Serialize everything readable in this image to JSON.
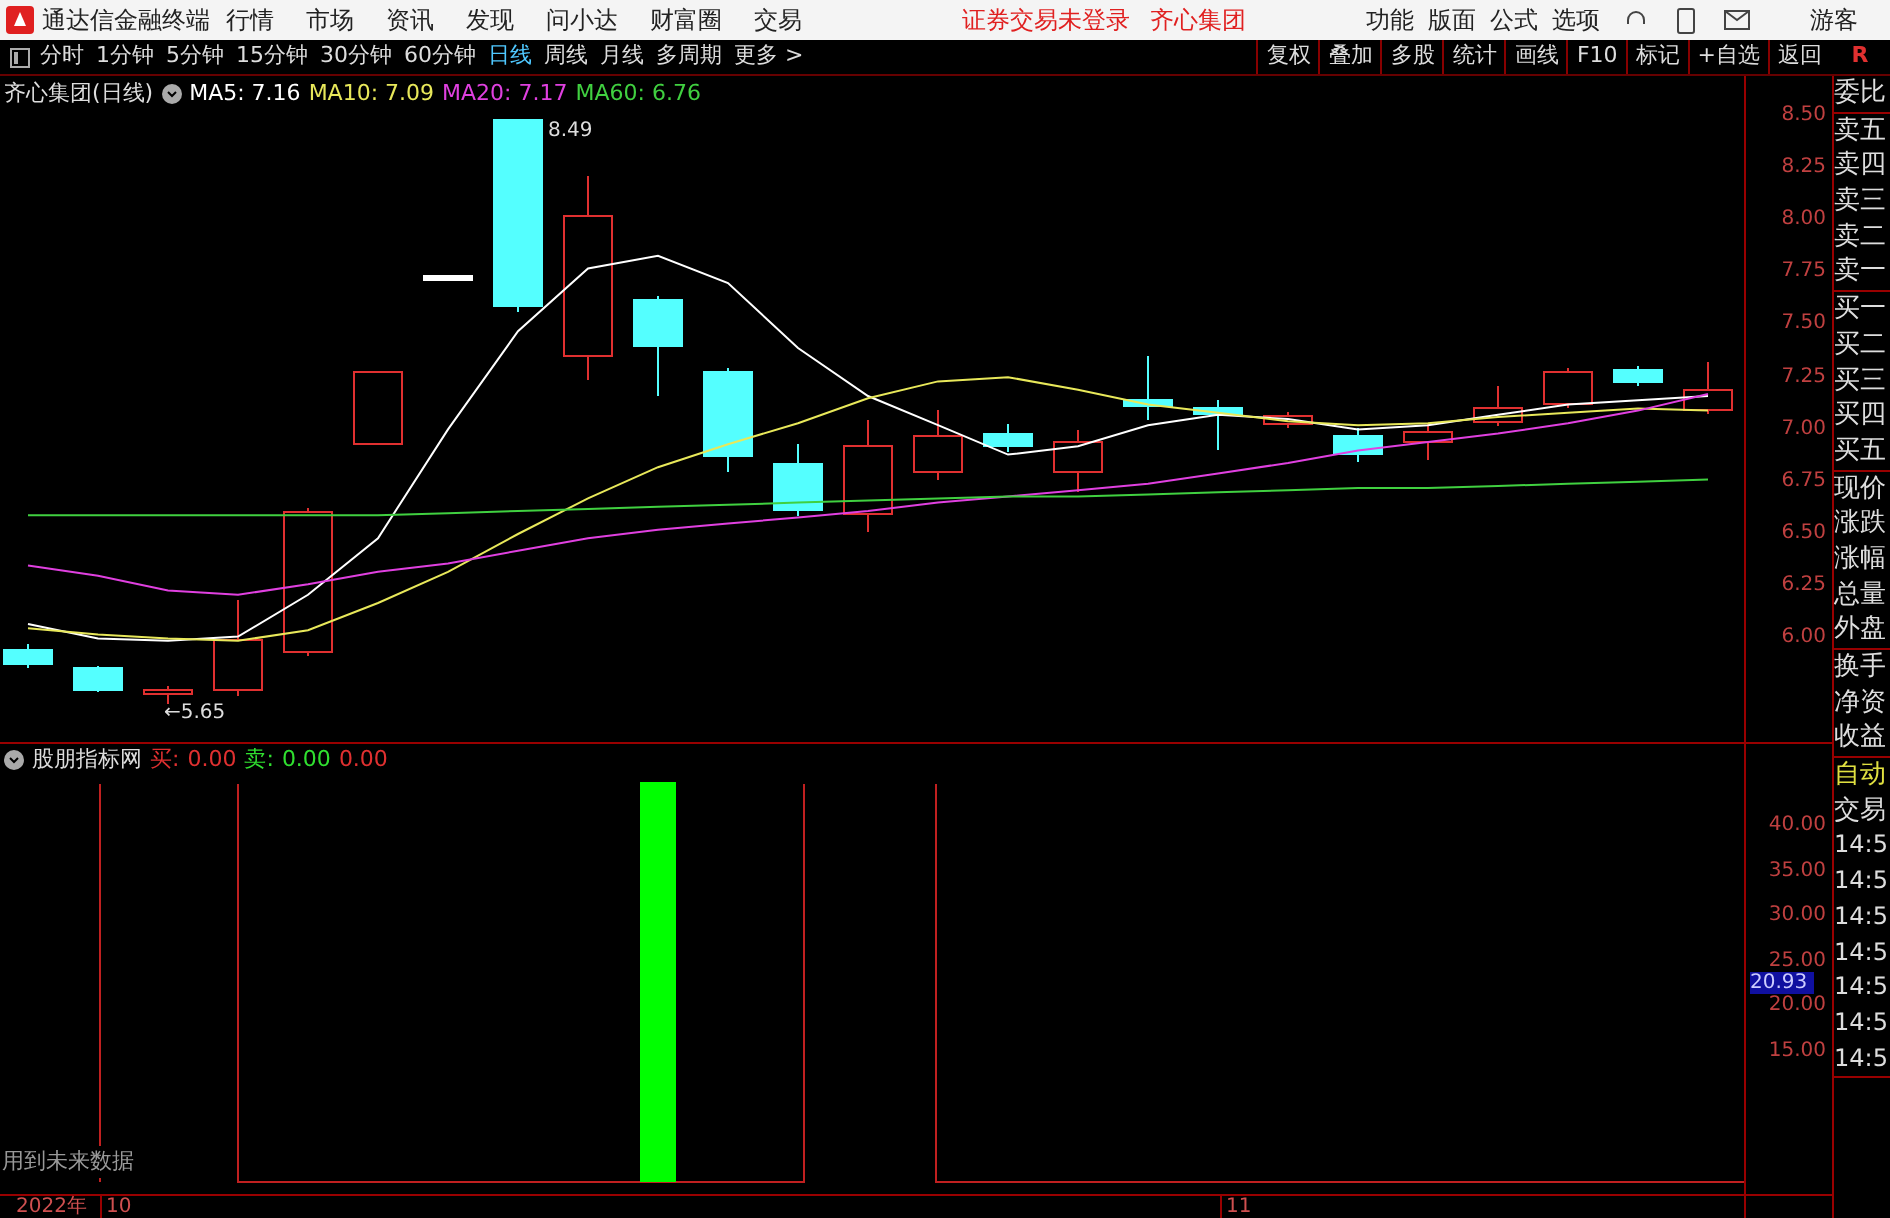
{
  "menu_bar": {
    "app_title": "通达信金融终端",
    "items": [
      "行情",
      "市场",
      "资讯",
      "发现",
      "问小达",
      "财富圈",
      "交易"
    ],
    "notices": [
      "证券交易未登录",
      "齐心集团"
    ],
    "right_items": [
      "功能",
      "版面",
      "公式",
      "选项"
    ],
    "user": "游客"
  },
  "toolbar": {
    "periods": [
      {
        "label": "分时",
        "selected": false
      },
      {
        "label": "1分钟",
        "selected": false
      },
      {
        "label": "5分钟",
        "selected": false
      },
      {
        "label": "15分钟",
        "selected": false
      },
      {
        "label": "30分钟",
        "selected": false
      },
      {
        "label": "60分钟",
        "selected": false
      },
      {
        "label": "日线",
        "selected": true
      },
      {
        "label": "周线",
        "selected": false
      },
      {
        "label": "月线",
        "selected": false
      },
      {
        "label": "多周期",
        "selected": false
      },
      {
        "label": "更多 >",
        "selected": false
      }
    ],
    "buttons": [
      "复权",
      "叠加",
      "多股",
      "统计",
      "画线",
      "F10",
      "标记",
      "+自选",
      "返回"
    ],
    "corner": "R"
  },
  "main_chart": {
    "title": "齐心集团(日线)",
    "indicators": [
      ": 7.16",
      ": 7.09",
      ": 7.17",
      ": 6.76"
    ],
    "high_label": "8.49",
    "low_label": "←5.65",
    "chart_data": {
      "type": "line",
      "categories": [
        null,
        null,
        null,
        null,
        null,
        null,
        null,
        null,
        null,
        null,
        null,
        null,
        null,
        null,
        null,
        null,
        null,
        null,
        null,
        null,
        null,
        null,
        null,
        null,
        null
      ],
      "ylim": [
        3.23,
        8.69
      ],
      "yticks": [
        {
          "value": 8.5,
          "label": "8.50"
        },
        {
          "value": 8.25,
          "label": "8.25"
        },
        {
          "value": 8.0,
          "label": "8.00"
        },
        {
          "value": 7.75,
          "label": "7.75"
        },
        {
          "value": 7.5,
          "label": "7.50"
        },
        {
          "value": 7.25,
          "label": "7.25"
        },
        {
          "value": 7.0,
          "label": "7.00"
        },
        {
          "value": 6.75,
          "label": "6.75"
        },
        {
          "value": 6.5,
          "label": "6.50"
        },
        {
          "value": 6.25,
          "label": "6.25"
        },
        {
          "value": 6.0,
          "label": "6.00"
        }
      ],
      "series": [
        {
          "name": "MA5",
          "color": "#ffffff",
          "values": [
            6.07,
            6.0,
            5.99,
            6.01,
            6.21,
            6.48,
            7.0,
            7.47,
            7.77,
            7.83,
            7.7,
            7.39,
            7.16,
            7.02,
            6.88,
            6.92,
            7.02,
            7.07,
            7.05,
            7.0,
            7.02,
            7.07,
            7.12,
            7.14,
            7.16
          ]
        },
        {
          "name": "MA10",
          "color": "#e8e85a",
          "values": [
            6.05,
            6.02,
            6.0,
            5.99,
            6.04,
            6.17,
            6.32,
            6.5,
            6.67,
            6.82,
            6.93,
            7.03,
            7.15,
            7.23,
            7.25,
            7.19,
            7.12,
            7.08,
            7.04,
            7.02,
            7.03,
            7.06,
            7.08,
            7.1,
            7.09
          ]
        },
        {
          "name": "MA20",
          "color": "#e040e0",
          "values": [
            6.35,
            6.3,
            6.23,
            6.21,
            6.26,
            6.32,
            6.36,
            6.42,
            6.48,
            6.52,
            6.55,
            6.58,
            6.61,
            6.65,
            6.68,
            6.71,
            6.74,
            6.79,
            6.84,
            6.9,
            6.94,
            6.98,
            7.03,
            7.09,
            7.17
          ]
        },
        {
          "name": "MA60",
          "color": "#40d040",
          "values": [
            6.59,
            6.59,
            6.59,
            6.59,
            6.59,
            6.59,
            6.6,
            6.61,
            6.62,
            6.63,
            6.64,
            6.65,
            6.66,
            6.67,
            6.68,
            6.68,
            6.69,
            6.7,
            6.71,
            6.72,
            6.72,
            6.73,
            6.74,
            6.75,
            6.76
          ]
        }
      ]
    }
  },
  "sub_chart": {
    "title": "股朋指标网",
    "values": [
      {
        "label": "买:",
        "color": "#e03030"
      },
      {
        "label": "0.00",
        "color": "#e03030"
      },
      {
        "label": "卖:",
        "color": "#30e030"
      },
      {
        "label": "0.00",
        "color": "#30e030"
      },
      {
        "label": "0.00",
        "color": "#e03030"
      }
    ],
    "yticks": [
      "40.00",
      "35.00",
      "30.00",
      "25.00",
      "20.00",
      "15.00"
    ],
    "current_value": "20.93",
    "note": "用到未来数据"
  },
  "x_axis": [
    "2022年",
    "10",
    "11"
  ],
  "side_panel": {
    "groups": [
      [
        {
          "label": "委比",
          "kind": "label"
        }
      ],
      [
        {
          "label": "卖五",
          "kind": "label"
        },
        {
          "label": "卖四",
          "kind": "label"
        },
        {
          "label": "卖三",
          "kind": "label"
        },
        {
          "label": "卖二",
          "kind": "label"
        },
        {
          "label": "卖一",
          "kind": "label"
        }
      ],
      [
        {
          "label": "买一",
          "kind": "label"
        },
        {
          "label": "买二",
          "kind": "label"
        },
        {
          "label": "买三",
          "kind": "label"
        },
        {
          "label": "买四",
          "kind": "label"
        },
        {
          "label": "买五",
          "kind": "label"
        }
      ],
      [
        {
          "label": "现价",
          "kind": "label"
        },
        {
          "label": "涨跌",
          "kind": "label"
        },
        {
          "label": "涨幅",
          "kind": "label"
        },
        {
          "label": "总量",
          "kind": "label"
        },
        {
          "label": "外盘",
          "kind": "label"
        }
      ],
      [
        {
          "label": "换手",
          "kind": "label"
        },
        {
          "label": "净资",
          "kind": "label"
        },
        {
          "label": "收益",
          "kind": "label"
        }
      ],
      [
        {
          "label": "自动",
          "kind": "auto"
        },
        {
          "label": "交易",
          "kind": "label"
        },
        {
          "label": "14:5",
          "kind": "time"
        },
        {
          "label": "14:5",
          "kind": "time"
        },
        {
          "label": "14:5",
          "kind": "time"
        },
        {
          "label": "14:5",
          "kind": "time"
        },
        {
          "label": "14:5",
          "kind": "time"
        },
        {
          "label": "14:5",
          "kind": "time"
        },
        {
          "label": "14:5",
          "kind": "time"
        }
      ]
    ]
  }
}
